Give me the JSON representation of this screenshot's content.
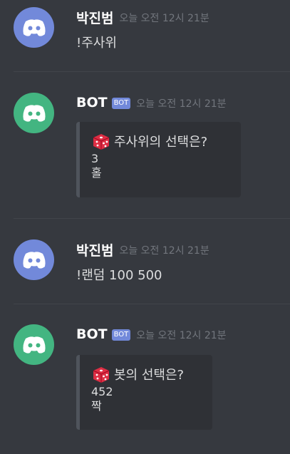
{
  "colors": {
    "background": "#36393f",
    "avatar_user": "#7289da",
    "avatar_bot": "#43b581",
    "bot_tag": "#7289da",
    "embed_bg": "#2f3136",
    "embed_border": "#4f545c",
    "dice": "#dd2e44"
  },
  "messages": [
    {
      "avatar_icon": "discord-logo-icon",
      "username": "박진범",
      "timestamp": "오늘 오전 12시 21분",
      "text": "!주사위"
    },
    {
      "avatar_icon": "discord-logo-icon",
      "username": "BOT",
      "bot_tag": "BOT",
      "timestamp": "오늘 오전 12시 21분",
      "embed": {
        "icon": "dice-icon",
        "title": "주사위의 선택은?",
        "line1": "3",
        "line2": "홀"
      }
    },
    {
      "avatar_icon": "discord-logo-icon",
      "username": "박진범",
      "timestamp": "오늘 오전 12시 21분",
      "text": "!랜덤 100 500"
    },
    {
      "avatar_icon": "discord-logo-icon",
      "username": "BOT",
      "bot_tag": "BOT",
      "timestamp": "오늘 오전 12시 21분",
      "embed": {
        "icon": "dice-icon",
        "title": "봇의 선택은?",
        "line1": "452",
        "line2": "짝"
      }
    }
  ]
}
